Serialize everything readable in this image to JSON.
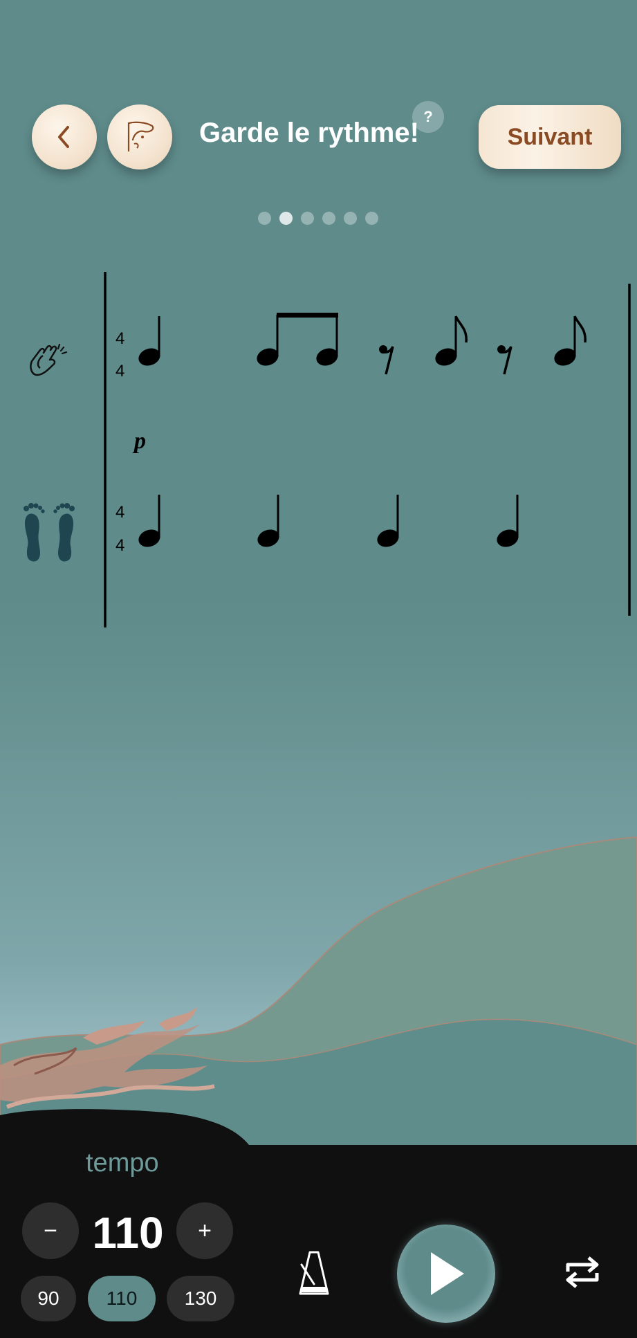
{
  "header": {
    "title": "Garde le rythme!",
    "help_label": "?",
    "next_label": "Suivant",
    "back_icon": "chevron-left-icon",
    "instrument_icon": "instrument-logo-icon"
  },
  "progress": {
    "total_steps": 6,
    "current_step": 2
  },
  "score": {
    "clap_staff": {
      "icon": "clapping-hands-icon",
      "time_signature_top": "4",
      "time_signature_bottom": "4",
      "dynamic": "p"
    },
    "feet_staff": {
      "icon": "footprints-icon",
      "time_signature_top": "4",
      "time_signature_bottom": "4"
    }
  },
  "controls": {
    "tempo_label": "tempo",
    "tempo_value": "110",
    "minus_label": "−",
    "plus_label": "+",
    "presets": [
      {
        "label": "90",
        "active": false
      },
      {
        "label": "110",
        "active": true
      },
      {
        "label": "130",
        "active": false
      }
    ],
    "metronome_icon": "metronome-icon",
    "play_icon": "play-icon",
    "repeat_icon": "repeat-icon"
  },
  "colors": {
    "background": "#5f8b8b",
    "accent_brown": "#8a4a23",
    "panel": "#101010",
    "button_cream": "#f4e3cf"
  }
}
